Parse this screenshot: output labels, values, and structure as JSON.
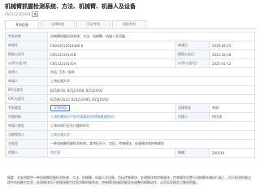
{
  "header": {
    "title": "机械臂抓握检测系统、方法、机械臂、机器人及设备",
    "patent_id": "CN112210145B",
    "copy_icon": "copy-icon"
  },
  "tabs": [
    {
      "label": "专利信息",
      "active": true
    },
    {
      "label": "法律状态",
      "active": false
    },
    {
      "label": "引证专利",
      "active": false
    },
    {
      "label": "同族专利",
      "active": false
    }
  ],
  "info": {
    "rows": [
      {
        "label": "专利名称",
        "value": "机械臂抓握检测系统、方法、机械臂、机器人及设备"
      },
      {
        "label": "申请号",
        "value": "CN202011014486.8",
        "label2": "申请日",
        "value2": "2020-09-23"
      },
      {
        "label": "授权公告号",
        "value": "CN112210145B",
        "label2": "授权公告日",
        "value2": "2022-03-18"
      },
      {
        "label": "公开(公告)号",
        "value": "CN112210145A",
        "label2": "公开(公告)日",
        "value2": "2021-01-12"
      },
      {
        "label": "发明人",
        "value": "刘远; 王东; 张林"
      },
      {
        "label": "申请人",
        "value": "上海交通大学"
      },
      {
        "label": "IPC分类号",
        "value": "B25J9/16; B25J13/08; B25J19/02"
      },
      {
        "label": "CPC分类号",
        "value": "B25J9/1612; B25J13/085; B25J19/02"
      },
      {
        "label": "专利类型",
        "value": "发明授权",
        "label2": "法律状态",
        "value2": "有效"
      },
      {
        "label": "代理机构",
        "value": "上海恒慧知识产权代理事务所(特殊普通合伙)",
        "label2": "代理人",
        "value2": "徐红银"
      },
      {
        "label": "申请人地址",
        "value": "上海市闵行区东川路800号"
      },
      {
        "label": "当前权利人",
        "value": "上海交通大学"
      },
      {
        "label": "主权项",
        "value": "一种机械臂抓握检测系统，其特征在于，包括：传感模块、处理模块和控制模块"
      },
      {
        "label": "代理人",
        "value": "徐红银",
        "label2": "邮编",
        "value2": "200240"
      }
    ]
  },
  "abstract": {
    "label": "摘要",
    "text": "本发明提供一种机械臂抓握检测系统、方法、机械臂、机器人及设备，包括传感模块、处理模块和控制模块；传感模块设置于机械臂末端执行器上，用于检测抓握过程中的接触力信息；处理模块用于根据接触力信息判断抓握状态；控制模块根据抓握状态调整机械臂动作，从而实现稳定可靠的抓握。"
  },
  "colors": {
    "accent": "#3d7ede",
    "label_bg": "#f3f6fa",
    "border": "#e3e3e3"
  }
}
